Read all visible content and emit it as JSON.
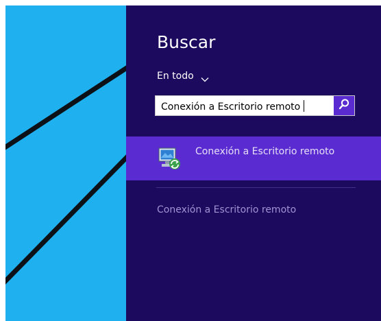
{
  "colors": {
    "desktop_background": "#1fb0f0",
    "desktop_lines": "#0b1116",
    "charm_background": "#1c0a5e",
    "accent": "#5a2bd1",
    "divider": "#41318a",
    "suggestion_text": "#9f93d3"
  },
  "charm": {
    "title": "Buscar",
    "scope": {
      "label": "En todo",
      "icon": "chevron-down-icon"
    },
    "search": {
      "value": "Conexión a Escritorio remoto",
      "button_icon": "search-icon"
    },
    "results": [
      {
        "label": "Conexión a Escritorio remoto",
        "icon": "remote-desktop-icon",
        "selected": true
      }
    ],
    "suggestions": [
      {
        "label": "Conexión a Escritorio remoto"
      }
    ]
  }
}
